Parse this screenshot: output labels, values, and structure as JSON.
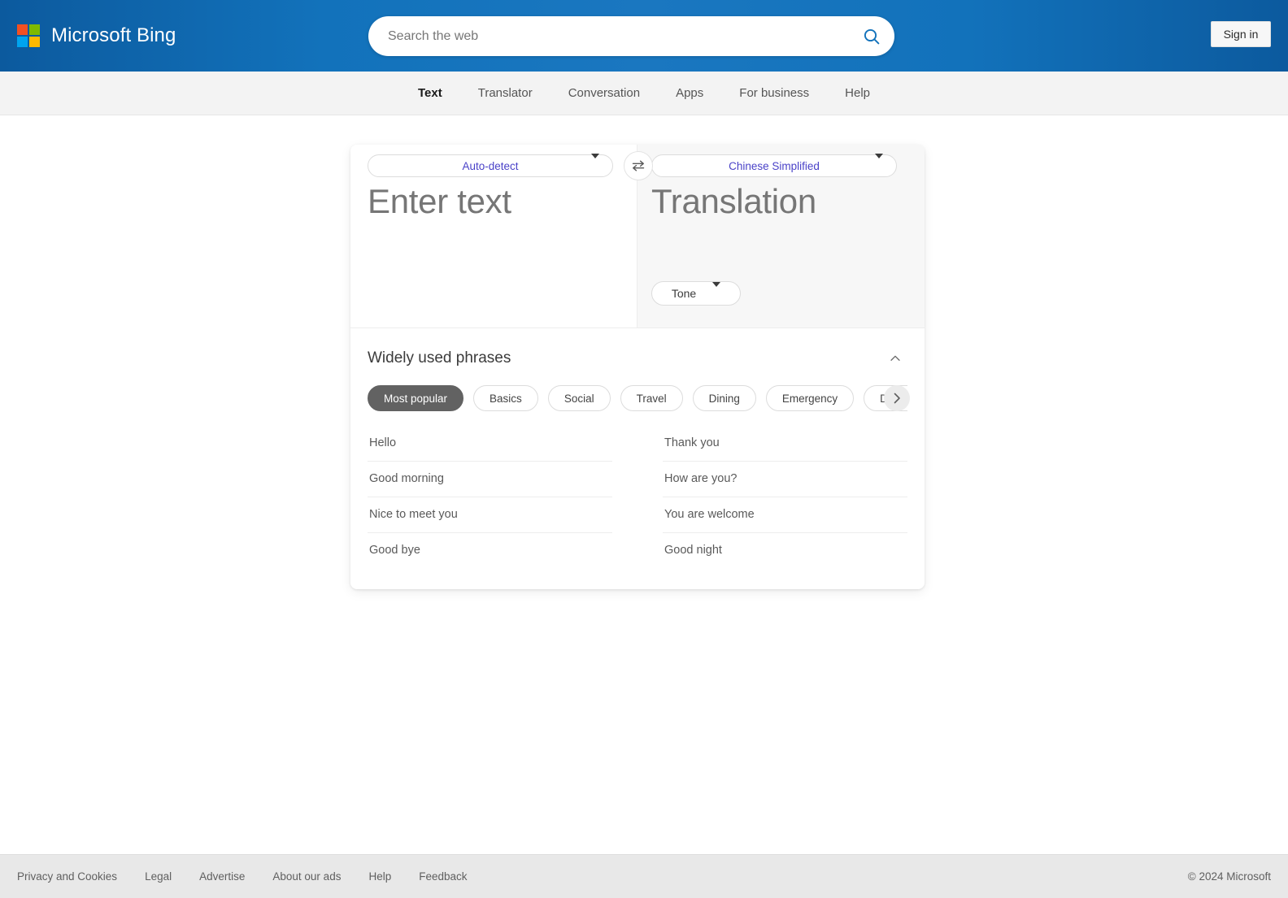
{
  "header": {
    "brand": "Microsoft Bing",
    "logo_colors": {
      "top_left": "#f25022",
      "top_right": "#7fba00",
      "bottom_left": "#00a4ef",
      "bottom_right": "#ffb900"
    },
    "search": {
      "placeholder": "Search the web",
      "value": "",
      "icon": "search-icon"
    },
    "signin_label": "Sign in",
    "background_accent": "#1272bb"
  },
  "nav": {
    "items": [
      {
        "label": "Text",
        "active": true
      },
      {
        "label": "Translator",
        "active": false
      },
      {
        "label": "Conversation",
        "active": false
      },
      {
        "label": "Apps",
        "active": false
      },
      {
        "label": "For business",
        "active": false
      },
      {
        "label": "Help",
        "active": false
      }
    ]
  },
  "translator": {
    "source": {
      "language": "Auto-detect",
      "placeholder": "Enter text",
      "value": ""
    },
    "target": {
      "language": "Chinese Simplified",
      "placeholder": "Translation",
      "value": "",
      "tone_label": "Tone"
    },
    "swap_icon": "swap-horizontal-icon",
    "language_text_color": "#4a42c8"
  },
  "phrases": {
    "title": "Widely used phrases",
    "collapse_icon": "chevron-up-icon",
    "next_icon": "chevron-right-icon",
    "categories": [
      {
        "label": "Most popular",
        "selected": true
      },
      {
        "label": "Basics",
        "selected": false
      },
      {
        "label": "Social",
        "selected": false
      },
      {
        "label": "Travel",
        "selected": false
      },
      {
        "label": "Dining",
        "selected": false
      },
      {
        "label": "Emergency",
        "selected": false
      },
      {
        "label": "Dates & numbers",
        "selected": false
      }
    ],
    "selected_pill_color": "#626262",
    "column_left": [
      "Hello",
      "Good morning",
      "Nice to meet you",
      "Good bye"
    ],
    "column_right": [
      "Thank you",
      "How are you?",
      "You are welcome",
      "Good night"
    ]
  },
  "footer": {
    "links": [
      "Privacy and Cookies",
      "Legal",
      "Advertise",
      "About our ads",
      "Help",
      "Feedback"
    ],
    "copyright": "© 2024 Microsoft"
  }
}
